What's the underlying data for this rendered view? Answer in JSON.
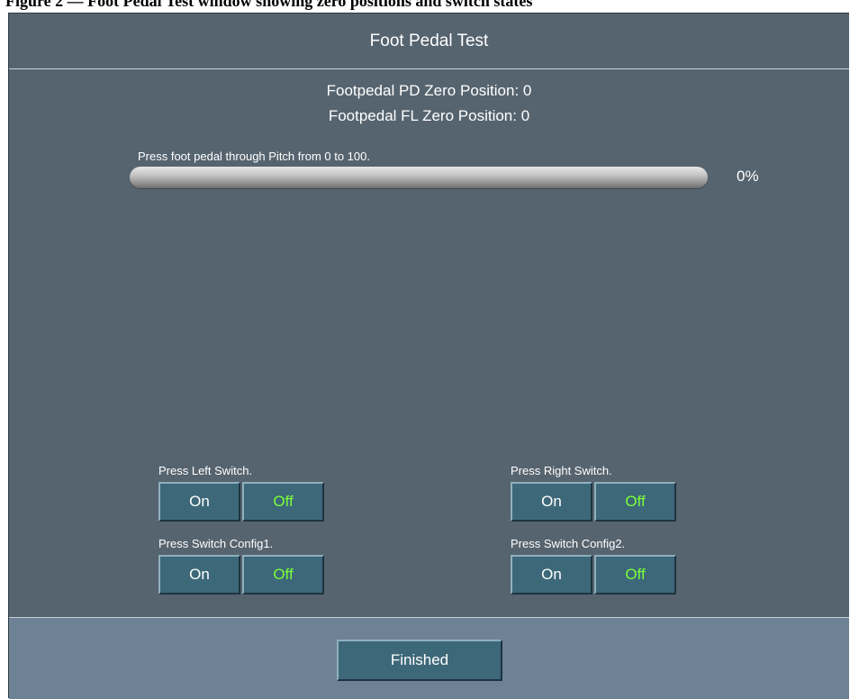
{
  "caption": "Figure 2 — Foot Pedal Test window showing zero positions and switch states",
  "dialog": {
    "title": "Foot Pedal Test",
    "zero_pd": "Footpedal PD Zero Position: 0",
    "zero_fl": "Footpedal FL Zero Position: 0",
    "prompt": "Press foot pedal through Pitch from 0 to 100.",
    "progress": {
      "value": 0,
      "label": "0%"
    },
    "switches": {
      "left": {
        "label": "Press Left Switch.",
        "on": "On",
        "off": "Off"
      },
      "right": {
        "label": "Press Right Switch.",
        "on": "On",
        "off": "Off"
      },
      "config1": {
        "label": "Press Switch Config1.",
        "on": "On",
        "off": "Off"
      },
      "config2": {
        "label": "Press Switch Config2.",
        "on": "On",
        "off": "Off"
      }
    },
    "finished_label": "Finished"
  },
  "colors": {
    "panel": "#56646f",
    "footer": "#6e8296",
    "button": "#3d6879",
    "off_text": "#7cff3a"
  }
}
